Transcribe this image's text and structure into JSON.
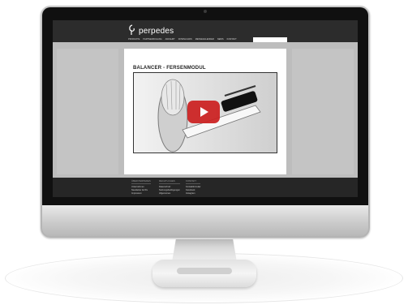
{
  "site": {
    "logo_text": "perpedes",
    "search_placeholder": "",
    "nav": [
      "Produkte",
      "Partnerzugang",
      "Anfahrt",
      "Downloads",
      "Messekalender",
      "News",
      "Kontakt"
    ],
    "page_title": "BALANCER - FERSENMODUL",
    "footer_columns": [
      {
        "heading": "Über Perpedes",
        "links": [
          "Unternehmen",
          "Newsletter Archiv",
          "Impressum"
        ]
      },
      {
        "heading": "Rechtliches",
        "links": [
          "Datenschutz",
          "Nutzungsbedingungen",
          "Allgemeines"
        ]
      },
      {
        "heading": "Kontakt",
        "links": [
          "Kontaktformular",
          "Facebook",
          "Instagram"
        ]
      }
    ]
  },
  "colors": {
    "header_bg": "#2c2c2c",
    "play_button": "#cc1f1f",
    "bezel": "#101010"
  },
  "icons": {
    "logo_mark": "swirl-footprint-icon",
    "play": "play-icon",
    "camera": "camera-dot"
  }
}
